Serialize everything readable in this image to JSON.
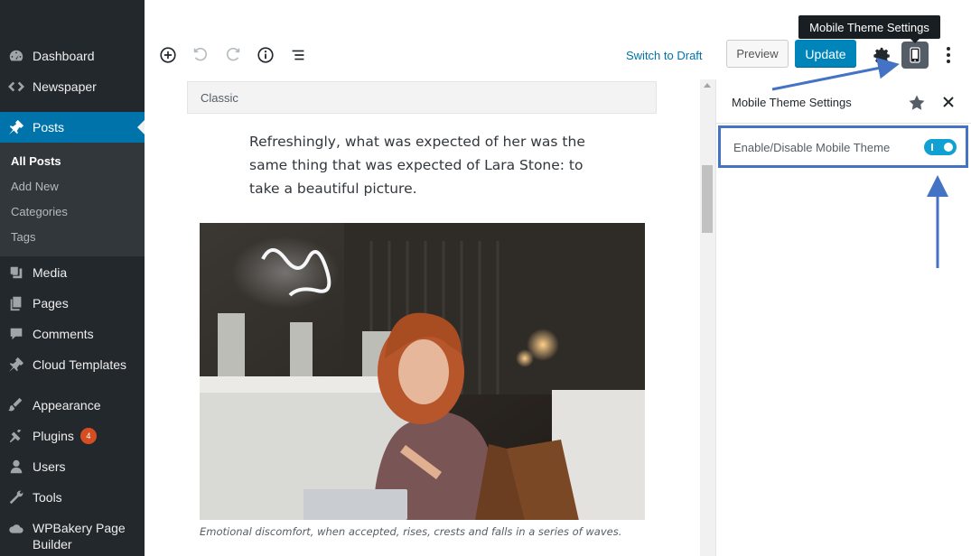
{
  "sidebar": {
    "items": [
      {
        "label": "Dashboard",
        "icon": "dashboard-icon"
      },
      {
        "label": "Newspaper",
        "icon": "newspaper-icon"
      },
      {
        "label": "Posts",
        "icon": "pin-icon"
      },
      {
        "label": "Media",
        "icon": "media-icon"
      },
      {
        "label": "Pages",
        "icon": "pages-icon"
      },
      {
        "label": "Comments",
        "icon": "comments-icon"
      },
      {
        "label": "Cloud Templates",
        "icon": "pin-icon"
      },
      {
        "label": "Appearance",
        "icon": "appearance-icon"
      },
      {
        "label": "Plugins",
        "icon": "plugins-icon",
        "badge": "4"
      },
      {
        "label": "Users",
        "icon": "users-icon"
      },
      {
        "label": "Tools",
        "icon": "tools-icon"
      },
      {
        "label": "WPBakery Page Builder",
        "icon": "wpbakery-icon"
      }
    ],
    "submenu": [
      "All Posts",
      "Add New",
      "Categories",
      "Tags"
    ],
    "colors": {
      "bg": "#23282d",
      "active": "#0073aa",
      "badge": "#d54e21"
    }
  },
  "toolbar": {
    "switch_draft": "Switch to Draft",
    "preview": "Preview",
    "update": "Update",
    "tooltip": "Mobile Theme Settings",
    "accent": "#0085ba"
  },
  "editor": {
    "block_label": "Classic",
    "paragraph": "Refreshingly, what was expected of her was the same thing that was expected of Lara Stone: to take a beautiful picture.",
    "caption": "Emotional discomfort, when accepted, rises, crests and falls in a series of waves."
  },
  "panel": {
    "title": "Mobile Theme Settings",
    "option_label": "Enable/Disable Mobile Theme",
    "toggle_on": true,
    "highlight_color": "#4472c4"
  }
}
